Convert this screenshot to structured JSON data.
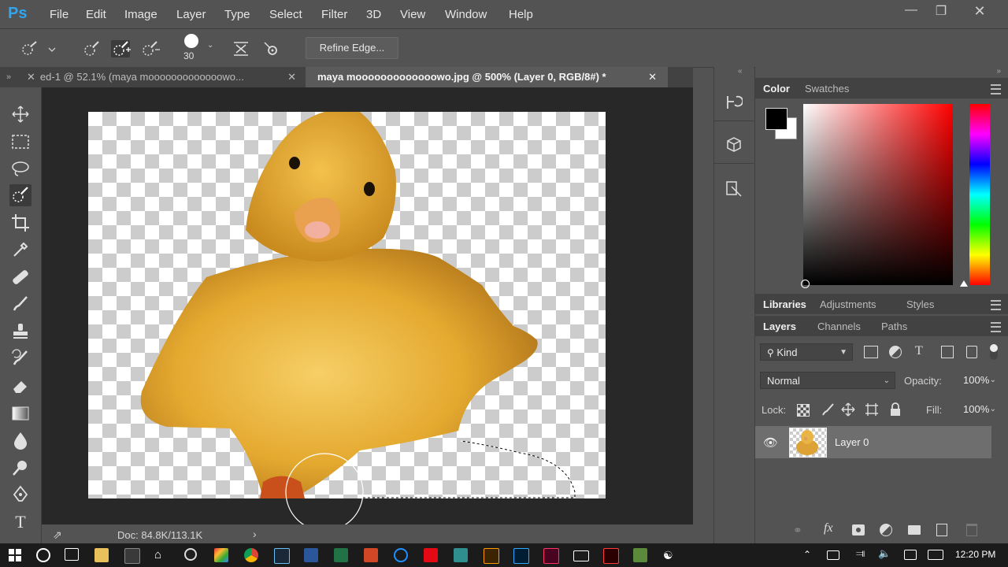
{
  "app": {
    "logo": "Ps"
  },
  "menu": [
    "File",
    "Edit",
    "Image",
    "Layer",
    "Type",
    "Select",
    "Filter",
    "3D",
    "View",
    "Window",
    "Help"
  ],
  "options_bar": {
    "brush_size": "30",
    "refine_edge_label": "Refine Edge..."
  },
  "tabs": [
    {
      "label": "ed-1 @ 52.1% (maya mooooooooooooowo...",
      "active": false
    },
    {
      "label": "maya mooooooooooooowo.jpg @ 500% (Layer 0, RGB/8#) *",
      "active": true
    }
  ],
  "status": {
    "doc_size": "Doc: 84.8K/113.1K"
  },
  "color_panel": {
    "tabs": [
      "Color",
      "Swatches"
    ],
    "foreground": "#000000",
    "background": "#ffffff",
    "hue_base": "#ff0000"
  },
  "libraries_panel": {
    "tabs": [
      "Libraries",
      "Adjustments",
      "Styles"
    ]
  },
  "layers_panel": {
    "tabs": [
      "Layers",
      "Channels",
      "Paths"
    ],
    "filter_kind": "Kind",
    "blend_mode": "Normal",
    "opacity_label": "Opacity:",
    "opacity_value": "100%",
    "lock_label": "Lock:",
    "fill_label": "Fill:",
    "fill_value": "100%",
    "layers": [
      {
        "name": "Layer 0",
        "visible": true
      }
    ]
  },
  "taskbar": {
    "time": "12:20 PM"
  }
}
